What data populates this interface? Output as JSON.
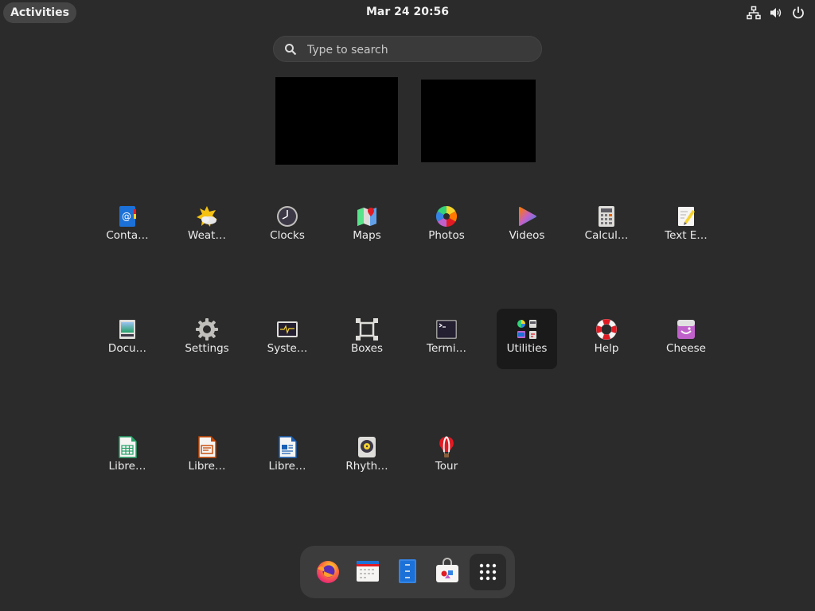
{
  "topbar": {
    "activities_label": "Activities",
    "clock": "Mar 24  20:56",
    "tray": [
      "network-icon",
      "volume-icon",
      "power-icon"
    ]
  },
  "search": {
    "placeholder": "Type to search"
  },
  "workspaces": [
    "workspace-1",
    "workspace-2"
  ],
  "apps": [
    {
      "label": "Conta…",
      "icon": "contacts-icon"
    },
    {
      "label": "Weat…",
      "icon": "weather-icon"
    },
    {
      "label": "Clocks",
      "icon": "clocks-icon"
    },
    {
      "label": "Maps",
      "icon": "maps-icon"
    },
    {
      "label": "Photos",
      "icon": "photos-icon"
    },
    {
      "label": "Videos",
      "icon": "videos-icon"
    },
    {
      "label": "Calcul…",
      "icon": "calculator-icon"
    },
    {
      "label": "Text E…",
      "icon": "text-editor-icon"
    },
    {
      "label": "Docu…",
      "icon": "document-viewer-icon"
    },
    {
      "label": "Settings",
      "icon": "settings-icon"
    },
    {
      "label": "Syste…",
      "icon": "system-monitor-icon"
    },
    {
      "label": "Boxes",
      "icon": "boxes-icon"
    },
    {
      "label": "Termi…",
      "icon": "terminal-icon"
    },
    {
      "label": "Utilities",
      "icon": "utilities-folder-icon"
    },
    {
      "label": "Help",
      "icon": "help-icon"
    },
    {
      "label": "Cheese",
      "icon": "cheese-icon"
    },
    {
      "label": "Libre…",
      "icon": "libreoffice-calc-icon"
    },
    {
      "label": "Libre…",
      "icon": "libreoffice-impress-icon"
    },
    {
      "label": "Libre…",
      "icon": "libreoffice-writer-icon"
    },
    {
      "label": "Rhyth…",
      "icon": "rhythmbox-icon"
    },
    {
      "label": "Tour",
      "icon": "tour-icon"
    }
  ],
  "dock": [
    "firefox-icon",
    "calendar-icon",
    "files-icon",
    "software-icon",
    "show-apps-icon"
  ],
  "colors": {
    "background": "#2b2b2b",
    "panel": "#3c3c3c",
    "highlight": "#1a1a1a",
    "text": "#ffffff"
  }
}
